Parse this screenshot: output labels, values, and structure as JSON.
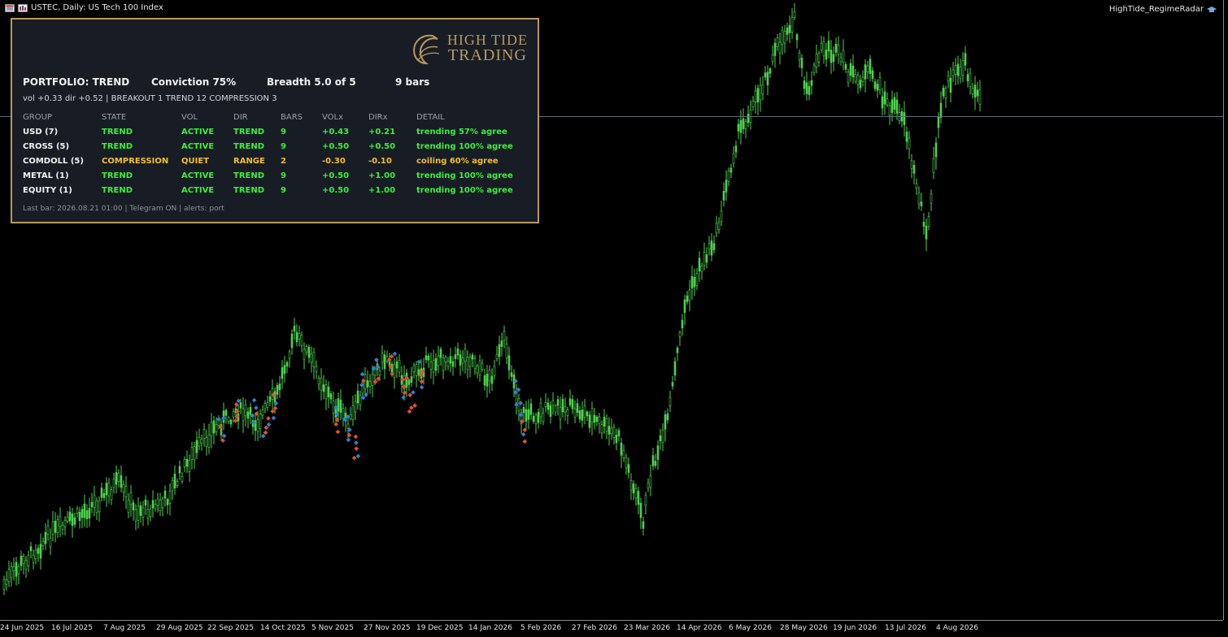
{
  "window": {
    "title": "USTEC, Daily:  US Tech 100 Index",
    "indicator": "HighTide_RegimeRadar"
  },
  "colors": {
    "background": "#000000",
    "candle": "#4fd14f",
    "panel_bg": "#181d25",
    "panel_border": "#b89a5f",
    "trend": "#3cf03c",
    "compression": "#f0c030",
    "marker_red": "#e0502a",
    "marker_blue": "#2f7fd6"
  },
  "time_axis": [
    "24 Jun 2025",
    "16 Jul 2025",
    "7 Aug 2025",
    "29 Aug 2025",
    "22 Sep 2025",
    "14 Oct 2025",
    "5 Nov 2025",
    "27 Nov 2025",
    "19 Dec 2025",
    "14 Jan 2026",
    "5 Feb 2026",
    "27 Feb 2026",
    "23 Mar 2026",
    "14 Apr 2026",
    "6 May 2026",
    "28 May 2026",
    "19 Jun 2026",
    "13 Jul 2026",
    "4 Aug 2026"
  ],
  "panel": {
    "logo": {
      "line1": "HIGH TIDE",
      "line2": "TRADING"
    },
    "portfolio": "PORTFOLIO: TREND",
    "conviction": "Conviction 75%",
    "breadth": "Breadth 5.0 of 5",
    "bars": "9 bars",
    "subline": "vol +0.33   dir +0.52    |    BREAKOUT 1   TREND 12   COMPRESSION 3",
    "columns": [
      "GROUP",
      "STATE",
      "VOL",
      "DIR",
      "BARS",
      "VOLx",
      "DIRx",
      "DETAIL"
    ],
    "rows": [
      {
        "group": "USD (7)",
        "state": "TREND",
        "vol": "ACTIVE",
        "dir": "TREND",
        "bars": "9",
        "volx": "+0.43",
        "dirx": "+0.21",
        "detail": "trending  57% agree",
        "tone": "green"
      },
      {
        "group": "CROSS (5)",
        "state": "TREND",
        "vol": "ACTIVE",
        "dir": "TREND",
        "bars": "9",
        "volx": "+0.50",
        "dirx": "+0.50",
        "detail": "trending  100% agree",
        "tone": "green"
      },
      {
        "group": "COMDOLL (5)",
        "state": "COMPRESSION",
        "vol": "QUIET",
        "dir": "RANGE",
        "bars": "2",
        "volx": "-0.30",
        "dirx": "-0.10",
        "detail": "coiling  60% agree",
        "tone": "amber"
      },
      {
        "group": "METAL (1)",
        "state": "TREND",
        "vol": "ACTIVE",
        "dir": "TREND",
        "bars": "9",
        "volx": "+0.50",
        "dirx": "+1.00",
        "detail": "trending  100% agree",
        "tone": "green"
      },
      {
        "group": "EQUITY (1)",
        "state": "TREND",
        "vol": "ACTIVE",
        "dir": "TREND",
        "bars": "9",
        "volx": "+0.50",
        "dirx": "+1.00",
        "detail": "trending  100% agree",
        "tone": "green"
      }
    ],
    "footer": "Last bar: 2026.08.21 01:00   |   Telegram ON   |   alerts: port"
  }
}
